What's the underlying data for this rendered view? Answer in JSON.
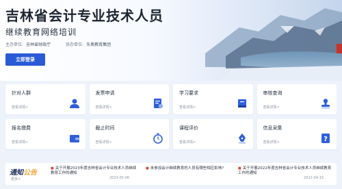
{
  "hero": {
    "title": "吉林省会计专业技术人员",
    "subtitle": "继续教育网络培训",
    "host_label": "主办单位:",
    "host_value": "吉林省财政厅",
    "co_label": "协办单位:",
    "co_value": "东奥教育集团",
    "login": "立即登录"
  },
  "cards": [
    {
      "title": "针对人群",
      "link": "查看详情>",
      "icon": "person-icon"
    },
    {
      "title": "发票申请",
      "link": "查看详情>",
      "icon": "invoice-icon"
    },
    {
      "title": "学习要求",
      "link": "查看详情>",
      "icon": "book-icon"
    },
    {
      "title": "审核查询",
      "link": "查看详情>",
      "icon": "stamp-icon"
    },
    {
      "title": "报名缴费",
      "link": "查看详情>",
      "icon": "wallet-icon"
    },
    {
      "title": "截止时间",
      "link": "查看详情>",
      "icon": "stopwatch-icon"
    },
    {
      "title": "课程评价",
      "link": "查看详情>",
      "icon": "pen-icon"
    },
    {
      "title": "信息采集",
      "link": "查看详情>",
      "icon": "question-icon"
    }
  ],
  "notice": {
    "title_a": "通知",
    "title_b": "公告",
    "more": "更多>",
    "items": [
      {
        "text": "关于开展2023年度吉林省会计专业技术人员继续教育工作的通知",
        "date": "2023-05-06"
      },
      {
        "text": "未参加会计继续教育的人员有哪些相应影响?",
        "date": ""
      },
      {
        "text": "关于开展2022年度吉林省会计专业技术人员继续教育工作的通知",
        "date": "2022-04-15"
      }
    ]
  },
  "colors": {
    "primary": "#2a5bd7",
    "accent": "#f0a53a",
    "icon_blue": "#2f5fd8"
  }
}
